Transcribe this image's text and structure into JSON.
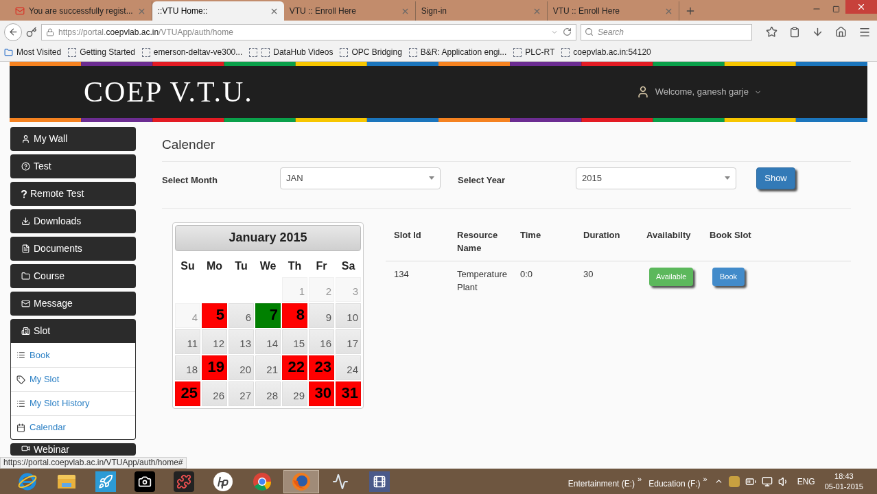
{
  "browser": {
    "tabs": [
      {
        "label": "You are successfully regist...",
        "kind": "mail",
        "selected": false
      },
      {
        "label": "::VTU Home::",
        "kind": "page",
        "selected": true
      },
      {
        "label": "VTU :: Enroll Here",
        "kind": "page",
        "selected": false
      },
      {
        "label": "Sign-in",
        "kind": "page",
        "selected": false
      },
      {
        "label": "VTU :: Enroll Here",
        "kind": "page",
        "selected": false
      }
    ],
    "url": {
      "prefix": "https://portal.",
      "host": "coepvlab.ac.in",
      "path": "/VTUApp/auth/home"
    },
    "search": {
      "placeholder": "Search"
    },
    "bookmarks": [
      {
        "label": "Most Visited",
        "kind": "folder"
      },
      {
        "label": "Getting Started",
        "kind": "page"
      },
      {
        "label": "emerson-deltav-ve300...",
        "kind": "page"
      },
      {
        "label": "DataHub Videos",
        "kind": "double"
      },
      {
        "label": "OPC Bridging",
        "kind": "page"
      },
      {
        "label": "B&R: Application engi...",
        "kind": "page"
      },
      {
        "label": "PLC-RT",
        "kind": "page"
      },
      {
        "label": "coepvlab.ac.in:54120",
        "kind": "page"
      }
    ]
  },
  "header": {
    "logo": "COEP V.T.U.",
    "welcome": "Welcome, ganesh garje"
  },
  "sidebar": {
    "items": [
      {
        "label": "My Wall",
        "kind": "user"
      },
      {
        "label": "Test",
        "kind": "question-circle"
      },
      {
        "label": "Remote Test",
        "kind": "question"
      },
      {
        "label": "Downloads",
        "kind": "download"
      },
      {
        "label": "Documents",
        "kind": "file"
      },
      {
        "label": "Course",
        "kind": "folder"
      },
      {
        "label": "Message",
        "kind": "mail"
      },
      {
        "label": "Slot",
        "kind": "building",
        "expanded": true,
        "children": [
          {
            "label": "Book",
            "kind": "list"
          },
          {
            "label": "My Slot",
            "kind": "tag"
          },
          {
            "label": "My Slot History",
            "kind": "list-alt"
          },
          {
            "label": "Calendar",
            "kind": "calendar"
          }
        ]
      },
      {
        "label": "Webinar",
        "kind": "video"
      }
    ]
  },
  "main": {
    "title": "Calender",
    "form": {
      "month_label": "Select Month",
      "month": "JAN",
      "year_label": "Select Year",
      "year": "2015",
      "button": "Show"
    },
    "calendar": {
      "title": "January 2015",
      "weekdays": [
        "Su",
        "Mo",
        "Tu",
        "We",
        "Th",
        "Fr",
        "Sa"
      ],
      "weeks": [
        [
          {
            "kind": "blank"
          },
          {
            "kind": "blank"
          },
          {
            "kind": "blank"
          },
          {
            "kind": "blank"
          },
          {
            "day": "1",
            "kind": "past"
          },
          {
            "day": "2",
            "kind": "past"
          },
          {
            "day": "3",
            "kind": "past"
          }
        ],
        [
          {
            "day": "4",
            "kind": "past"
          },
          {
            "day": "5",
            "kind": "booked"
          },
          {
            "day": "6",
            "kind": "open"
          },
          {
            "day": "7",
            "kind": "today"
          },
          {
            "day": "8",
            "kind": "booked"
          },
          {
            "day": "9",
            "kind": "open"
          },
          {
            "day": "10",
            "kind": "open"
          }
        ],
        [
          {
            "day": "11",
            "kind": "open"
          },
          {
            "day": "12",
            "kind": "open"
          },
          {
            "day": "13",
            "kind": "open"
          },
          {
            "day": "14",
            "kind": "open"
          },
          {
            "day": "15",
            "kind": "open"
          },
          {
            "day": "16",
            "kind": "open"
          },
          {
            "day": "17",
            "kind": "open"
          }
        ],
        [
          {
            "day": "18",
            "kind": "open"
          },
          {
            "day": "19",
            "kind": "booked"
          },
          {
            "day": "20",
            "kind": "open"
          },
          {
            "day": "21",
            "kind": "open"
          },
          {
            "day": "22",
            "kind": "booked"
          },
          {
            "day": "23",
            "kind": "booked"
          },
          {
            "day": "24",
            "kind": "open"
          }
        ],
        [
          {
            "day": "25",
            "kind": "booked"
          },
          {
            "day": "26",
            "kind": "open"
          },
          {
            "day": "27",
            "kind": "open"
          },
          {
            "day": "28",
            "kind": "open"
          },
          {
            "day": "29",
            "kind": "open"
          },
          {
            "day": "30",
            "kind": "booked"
          },
          {
            "day": "31",
            "kind": "booked"
          }
        ]
      ]
    },
    "table": {
      "columns": [
        "Slot Id",
        "Resource Name",
        "Time",
        "Duration",
        "Availabilty",
        "Book Slot"
      ],
      "rows": [
        {
          "slot_id": "134",
          "resource": "Temperature Plant",
          "time": "0:0",
          "duration": "30",
          "availability": "Available",
          "action": "Book"
        }
      ]
    }
  },
  "status_url": "https://portal.coepvlab.ac.in/VTUApp/auth/home#",
  "taskbar": {
    "apps": [
      {
        "kind": "ie",
        "selected": false
      },
      {
        "kind": "explorer",
        "selected": false
      },
      {
        "kind": "rocket",
        "selected": false
      },
      {
        "kind": "camera",
        "selected": false
      },
      {
        "kind": "puzzle",
        "selected": false
      },
      {
        "kind": "hp",
        "selected": false
      },
      {
        "kind": "chrome",
        "selected": false
      },
      {
        "kind": "firefox",
        "selected": true
      },
      {
        "kind": "monitor",
        "selected": false
      },
      {
        "kind": "video",
        "selected": false
      }
    ],
    "toolbars": [
      "Entertainment (E:)",
      "Education (F:)"
    ],
    "chevron": "»",
    "language": "ENG",
    "time": "18:43",
    "date": "05-01-2015"
  }
}
